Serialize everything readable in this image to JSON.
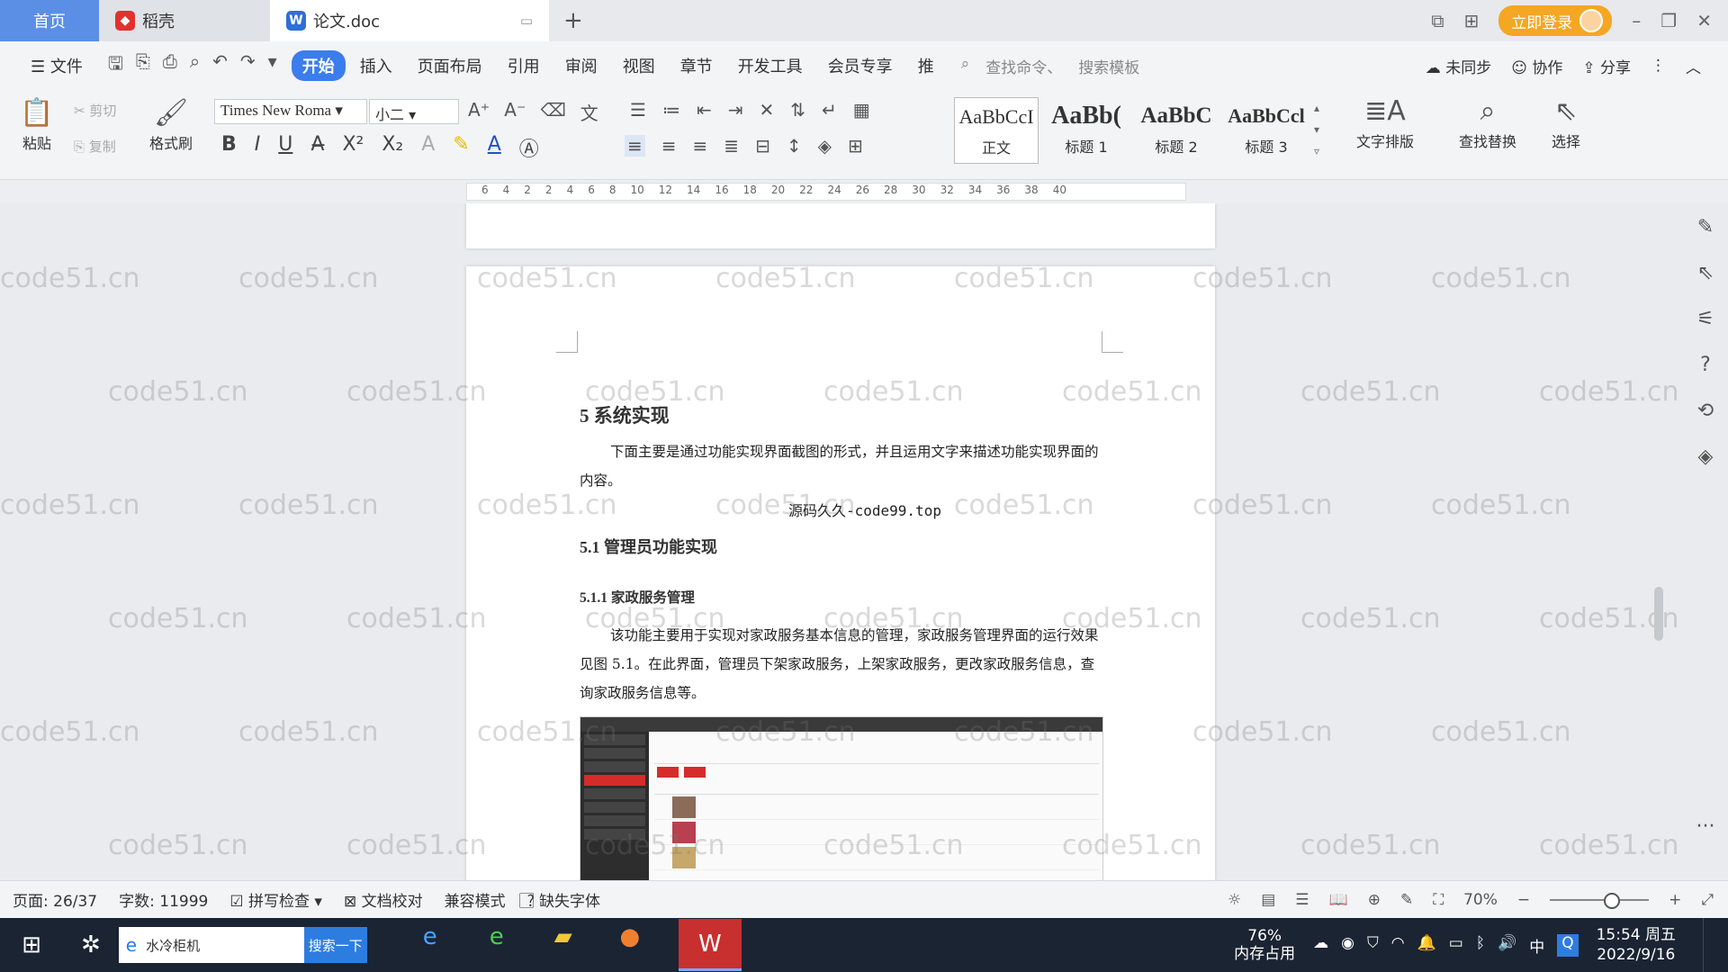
{
  "tabs": {
    "home": "首页",
    "daoke": "稻壳",
    "doc": "论文.doc",
    "login": "立即登录"
  },
  "menu": {
    "file": "文件",
    "items": [
      "开始",
      "插入",
      "页面布局",
      "引用",
      "审阅",
      "视图",
      "章节",
      "开发工具",
      "会员专享",
      "推"
    ],
    "search_cmd": "查找命令、",
    "search_tpl": "搜索模板",
    "sync": "未同步",
    "collab": "协作",
    "share": "分享"
  },
  "ribbon": {
    "paste": "粘贴",
    "cut": "剪切",
    "copy": "复制",
    "format_painter": "格式刷",
    "font_name": "Times New Roma",
    "font_size": "小二",
    "styles": [
      {
        "preview": "AaBbCcI",
        "name": "正文"
      },
      {
        "preview": "AaBb(",
        "name": "标题 1"
      },
      {
        "preview": "AaBbC",
        "name": "标题 2"
      },
      {
        "preview": "AaBbCcl",
        "name": "标题 3"
      }
    ],
    "text_layout": "文字排版",
    "find_replace": "查找替换",
    "select": "选择"
  },
  "ruler": {
    "ticks": [
      "6",
      "4",
      "2",
      "2",
      "4",
      "6",
      "8",
      "10",
      "12",
      "14",
      "16",
      "18",
      "20",
      "22",
      "24",
      "26",
      "28",
      "30",
      "32",
      "34",
      "36",
      "38",
      "40"
    ]
  },
  "doc": {
    "h1": "5  系统实现",
    "p1": "下面主要是通过功能实现界面截图的形式，并且运用文字来描述功能实现界面的内容。",
    "overlay": "源码久久-code99.top",
    "h2": "5.1  管理员功能实现",
    "h3": "5.1.1  家政服务管理",
    "p2": "该功能主要用于实现对家政服务基本信息的管理，家政服务管理界面的运行效果见图 5.1。在此界面，管理员下架家政服务，上架家政服务，更改家政服务信息，查询家政服务信息等。"
  },
  "watermark": "code51.cn",
  "status": {
    "page": "页面: 26/37",
    "words": "字数: 11999",
    "spell": "拼写检查",
    "proof": "文档校对",
    "compat": "兼容模式",
    "missing_font": "缺失字体",
    "zoom": "70%"
  },
  "taskbar": {
    "search_text": "水冷柜机",
    "search_btn": "搜索一下",
    "mem_pct": "76%",
    "mem_label": "内存占用",
    "ime": "中",
    "time": "15:54 周五",
    "date": "2022/9/16"
  }
}
